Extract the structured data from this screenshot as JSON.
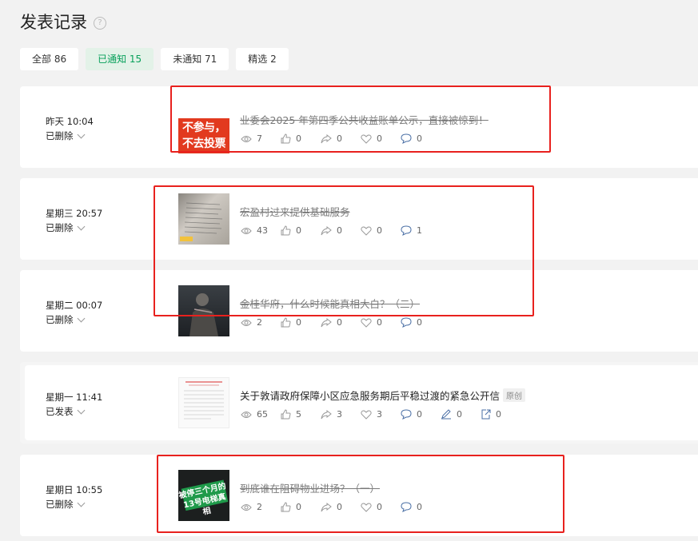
{
  "header": {
    "title": "发表记录",
    "help_icon": "?"
  },
  "tabs": [
    {
      "label": "全部 86"
    },
    {
      "label": "已通知 15"
    },
    {
      "label": "未通知 71"
    },
    {
      "label": "精选 2"
    }
  ],
  "posts": [
    {
      "time": "昨天 10:04",
      "status": "已删除",
      "thumb_text": "不参与，\n不去投票",
      "title": "业委会2025 年第四季公共收益账单公示，直接被惊到！",
      "views": "7",
      "likes": "0",
      "shares": "0",
      "favs": "0",
      "comments": "0"
    },
    {
      "time": "星期三 20:57",
      "status": "已删除",
      "title": "宏盈村过来提供基础服务",
      "views": "43",
      "likes": "0",
      "shares": "0",
      "favs": "0",
      "comments": "1"
    },
    {
      "time": "星期二 00:07",
      "status": "已删除",
      "title": "金桂华府，什么时候能真相大白？（二）",
      "views": "2",
      "likes": "0",
      "shares": "0",
      "favs": "0",
      "comments": "0"
    },
    {
      "time": "星期一 11:41",
      "status": "已发表",
      "title": "关于敦请政府保障小区应急服务期后平稳过渡的紧急公开信",
      "badge": "原创",
      "views": "65",
      "likes": "5",
      "shares": "3",
      "favs": "3",
      "comments": "0",
      "edits": "0",
      "exports": "0"
    },
    {
      "time": "星期日 10:55",
      "status": "已删除",
      "thumb_text": "被停三个月的\n13号电梯真相",
      "title": "到底谁在阻碍物业进场？（一）",
      "views": "2",
      "likes": "0",
      "shares": "0",
      "favs": "0",
      "comments": "0"
    }
  ],
  "colors": {
    "accent_green": "#07a05a",
    "highlight_red": "#e8211e"
  }
}
